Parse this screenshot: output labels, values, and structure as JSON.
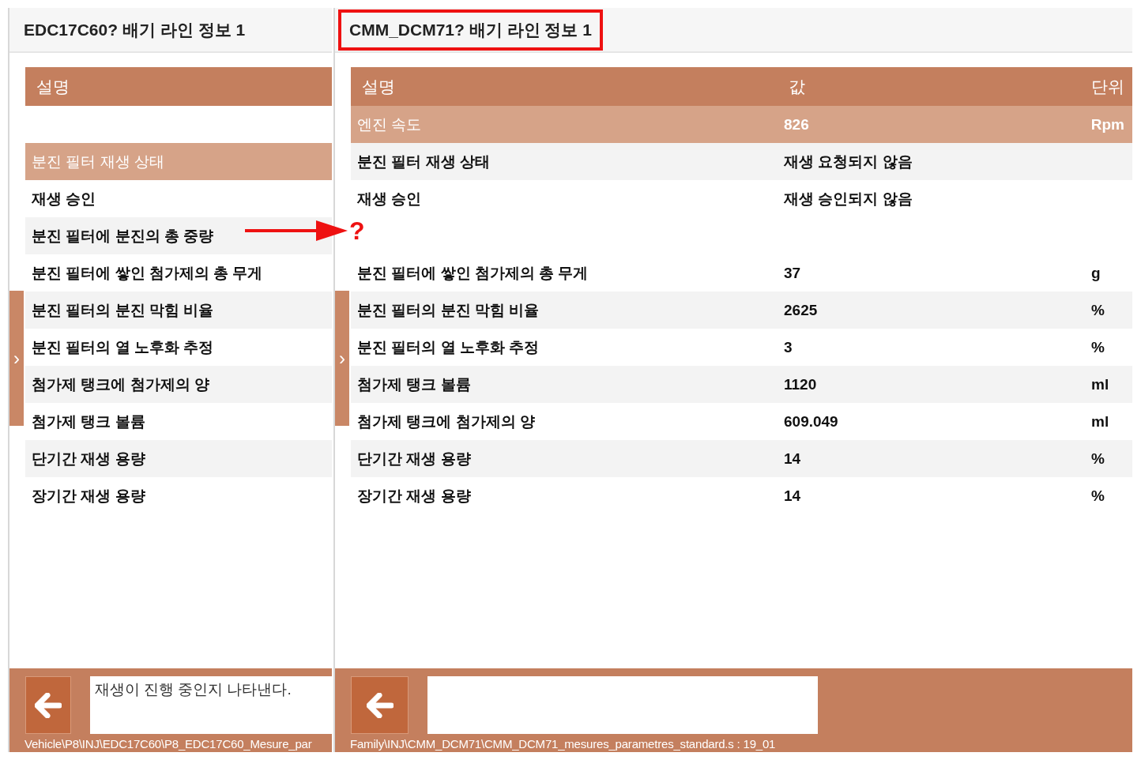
{
  "panels": [
    {
      "title": "EDC17C60? 배기 라인 정보 1",
      "title_highlighted": false,
      "columns": [
        "설명"
      ],
      "rows": [
        {
          "kind": "gap"
        },
        {
          "kind": "data",
          "selected": true,
          "cells": [
            "분진 필터 재생 상태"
          ]
        },
        {
          "kind": "data",
          "selected": false,
          "cells": [
            "재생 승인"
          ]
        },
        {
          "kind": "data",
          "selected": false,
          "cells": [
            "분진 필터에 분진의 총 중량"
          ]
        },
        {
          "kind": "data",
          "selected": false,
          "cells": [
            "분진 필터에 쌓인 첨가제의 총 무게"
          ]
        },
        {
          "kind": "data",
          "selected": false,
          "cells": [
            "분진 필터의 분진 막힘 비율"
          ]
        },
        {
          "kind": "data",
          "selected": false,
          "cells": [
            "분진 필터의 열 노후화 추정"
          ]
        },
        {
          "kind": "data",
          "selected": false,
          "cells": [
            "첨가제 탱크에 첨가제의 양"
          ]
        },
        {
          "kind": "data",
          "selected": false,
          "cells": [
            "첨가제 탱크 볼륨"
          ]
        },
        {
          "kind": "data",
          "selected": false,
          "cells": [
            "단기간 재생 용량"
          ]
        },
        {
          "kind": "data",
          "selected": false,
          "cells": [
            "장기간 재생 용량"
          ]
        }
      ],
      "side_tab": "›",
      "description": "재생이 진행 중인지 나타낸다.",
      "path": "Vehicle\\P8\\INJ\\EDC17C60\\P8_EDC17C60_Mesure_par"
    },
    {
      "title": "CMM_DCM71? 배기 라인 정보 1",
      "title_highlighted": true,
      "columns": [
        "설명",
        "값",
        "단위"
      ],
      "rows": [
        {
          "kind": "data",
          "selected": true,
          "cells": [
            "엔진 속도",
            "826",
            "Rpm"
          ]
        },
        {
          "kind": "data",
          "selected": false,
          "cells": [
            "분진 필터 재생 상태",
            "재생 요청되지 않음"
          ]
        },
        {
          "kind": "data",
          "selected": false,
          "cells": [
            "재생 승인",
            "재생 승인되지 않음"
          ]
        },
        {
          "kind": "gap"
        },
        {
          "kind": "data",
          "selected": false,
          "cells": [
            "분진 필터에 쌓인 첨가제의 총 무게",
            "37",
            "g"
          ]
        },
        {
          "kind": "data",
          "selected": false,
          "cells": [
            "분진 필터의 분진 막힘 비율",
            "2625",
            "%"
          ]
        },
        {
          "kind": "data",
          "selected": false,
          "cells": [
            "분진 필터의 열 노후화 추정",
            "3",
            "%"
          ]
        },
        {
          "kind": "data",
          "selected": false,
          "cells": [
            "첨가제 탱크 볼륨",
            "1120",
            "ml"
          ]
        },
        {
          "kind": "data",
          "selected": false,
          "cells": [
            "첨가제 탱크에 첨가제의 양",
            "609.049",
            "ml"
          ]
        },
        {
          "kind": "data",
          "selected": false,
          "cells": [
            "단기간 재생 용량",
            "14",
            "%"
          ]
        },
        {
          "kind": "data",
          "selected": false,
          "cells": [
            "장기간 재생 용량",
            "14",
            "%"
          ]
        }
      ],
      "side_tab": "›",
      "path": "Family\\INJ\\CMM_DCM71\\CMM_DCM71_mesures_parametres_standard.s : 19_01"
    }
  ],
  "annotation": {
    "label": "?"
  }
}
